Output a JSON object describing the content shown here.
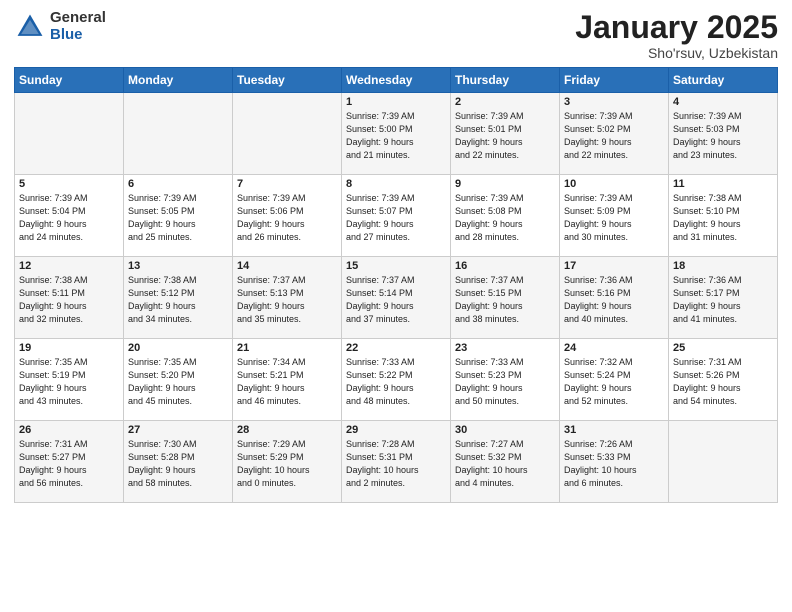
{
  "header": {
    "logo_general": "General",
    "logo_blue": "Blue",
    "title": "January 2025",
    "location": "Sho'rsuv, Uzbekistan"
  },
  "weekdays": [
    "Sunday",
    "Monday",
    "Tuesday",
    "Wednesday",
    "Thursday",
    "Friday",
    "Saturday"
  ],
  "weeks": [
    [
      {
        "day": "",
        "info": ""
      },
      {
        "day": "",
        "info": ""
      },
      {
        "day": "",
        "info": ""
      },
      {
        "day": "1",
        "info": "Sunrise: 7:39 AM\nSunset: 5:00 PM\nDaylight: 9 hours\nand 21 minutes."
      },
      {
        "day": "2",
        "info": "Sunrise: 7:39 AM\nSunset: 5:01 PM\nDaylight: 9 hours\nand 22 minutes."
      },
      {
        "day": "3",
        "info": "Sunrise: 7:39 AM\nSunset: 5:02 PM\nDaylight: 9 hours\nand 22 minutes."
      },
      {
        "day": "4",
        "info": "Sunrise: 7:39 AM\nSunset: 5:03 PM\nDaylight: 9 hours\nand 23 minutes."
      }
    ],
    [
      {
        "day": "5",
        "info": "Sunrise: 7:39 AM\nSunset: 5:04 PM\nDaylight: 9 hours\nand 24 minutes."
      },
      {
        "day": "6",
        "info": "Sunrise: 7:39 AM\nSunset: 5:05 PM\nDaylight: 9 hours\nand 25 minutes."
      },
      {
        "day": "7",
        "info": "Sunrise: 7:39 AM\nSunset: 5:06 PM\nDaylight: 9 hours\nand 26 minutes."
      },
      {
        "day": "8",
        "info": "Sunrise: 7:39 AM\nSunset: 5:07 PM\nDaylight: 9 hours\nand 27 minutes."
      },
      {
        "day": "9",
        "info": "Sunrise: 7:39 AM\nSunset: 5:08 PM\nDaylight: 9 hours\nand 28 minutes."
      },
      {
        "day": "10",
        "info": "Sunrise: 7:39 AM\nSunset: 5:09 PM\nDaylight: 9 hours\nand 30 minutes."
      },
      {
        "day": "11",
        "info": "Sunrise: 7:38 AM\nSunset: 5:10 PM\nDaylight: 9 hours\nand 31 minutes."
      }
    ],
    [
      {
        "day": "12",
        "info": "Sunrise: 7:38 AM\nSunset: 5:11 PM\nDaylight: 9 hours\nand 32 minutes."
      },
      {
        "day": "13",
        "info": "Sunrise: 7:38 AM\nSunset: 5:12 PM\nDaylight: 9 hours\nand 34 minutes."
      },
      {
        "day": "14",
        "info": "Sunrise: 7:37 AM\nSunset: 5:13 PM\nDaylight: 9 hours\nand 35 minutes."
      },
      {
        "day": "15",
        "info": "Sunrise: 7:37 AM\nSunset: 5:14 PM\nDaylight: 9 hours\nand 37 minutes."
      },
      {
        "day": "16",
        "info": "Sunrise: 7:37 AM\nSunset: 5:15 PM\nDaylight: 9 hours\nand 38 minutes."
      },
      {
        "day": "17",
        "info": "Sunrise: 7:36 AM\nSunset: 5:16 PM\nDaylight: 9 hours\nand 40 minutes."
      },
      {
        "day": "18",
        "info": "Sunrise: 7:36 AM\nSunset: 5:17 PM\nDaylight: 9 hours\nand 41 minutes."
      }
    ],
    [
      {
        "day": "19",
        "info": "Sunrise: 7:35 AM\nSunset: 5:19 PM\nDaylight: 9 hours\nand 43 minutes."
      },
      {
        "day": "20",
        "info": "Sunrise: 7:35 AM\nSunset: 5:20 PM\nDaylight: 9 hours\nand 45 minutes."
      },
      {
        "day": "21",
        "info": "Sunrise: 7:34 AM\nSunset: 5:21 PM\nDaylight: 9 hours\nand 46 minutes."
      },
      {
        "day": "22",
        "info": "Sunrise: 7:33 AM\nSunset: 5:22 PM\nDaylight: 9 hours\nand 48 minutes."
      },
      {
        "day": "23",
        "info": "Sunrise: 7:33 AM\nSunset: 5:23 PM\nDaylight: 9 hours\nand 50 minutes."
      },
      {
        "day": "24",
        "info": "Sunrise: 7:32 AM\nSunset: 5:24 PM\nDaylight: 9 hours\nand 52 minutes."
      },
      {
        "day": "25",
        "info": "Sunrise: 7:31 AM\nSunset: 5:26 PM\nDaylight: 9 hours\nand 54 minutes."
      }
    ],
    [
      {
        "day": "26",
        "info": "Sunrise: 7:31 AM\nSunset: 5:27 PM\nDaylight: 9 hours\nand 56 minutes."
      },
      {
        "day": "27",
        "info": "Sunrise: 7:30 AM\nSunset: 5:28 PM\nDaylight: 9 hours\nand 58 minutes."
      },
      {
        "day": "28",
        "info": "Sunrise: 7:29 AM\nSunset: 5:29 PM\nDaylight: 10 hours\nand 0 minutes."
      },
      {
        "day": "29",
        "info": "Sunrise: 7:28 AM\nSunset: 5:31 PM\nDaylight: 10 hours\nand 2 minutes."
      },
      {
        "day": "30",
        "info": "Sunrise: 7:27 AM\nSunset: 5:32 PM\nDaylight: 10 hours\nand 4 minutes."
      },
      {
        "day": "31",
        "info": "Sunrise: 7:26 AM\nSunset: 5:33 PM\nDaylight: 10 hours\nand 6 minutes."
      },
      {
        "day": "",
        "info": ""
      }
    ]
  ]
}
